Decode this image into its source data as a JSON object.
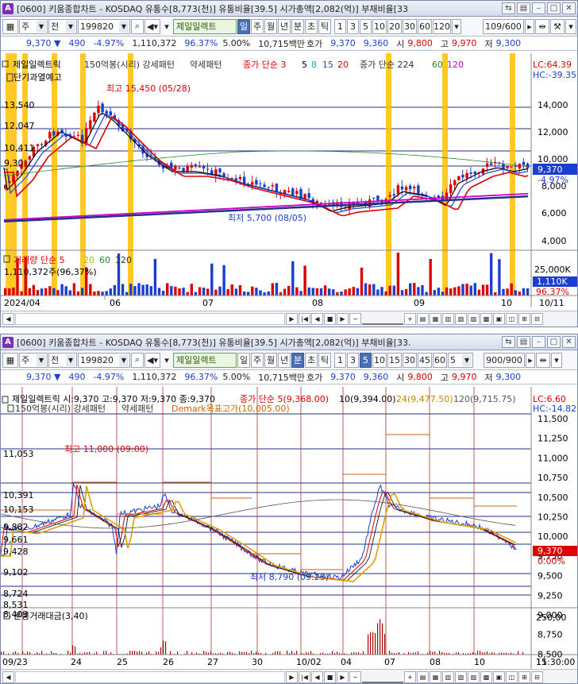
{
  "top": {
    "title": "[0600] 키움종합차트 - KOSDAQ 유통수[8,773(천)] 유통비율[39.5] 시가총액[2,082(억)] 부채비율[33",
    "toolbar": {
      "qty": "주",
      "prev": "전",
      "code": "199820",
      "stock": "제일일렉트",
      "periods": [
        "일",
        "주",
        "월",
        "년",
        "분",
        "초",
        "틱"
      ],
      "active_period": "일",
      "nums": [
        "1",
        "3",
        "5",
        "10",
        "20",
        "30",
        "60",
        "120"
      ],
      "count": "109/600"
    },
    "quote": {
      "price": "9,370 ▼",
      "change": "490",
      "rate": "-4.97%",
      "volume": "1,110,372",
      "vol_rate": "96.37%",
      "pct": "5.00%",
      "amount": "10,715백만",
      "hoga_label": "호가",
      "hoga1": "9,370",
      "hoga2": "9,360",
      "si_label": "시",
      "si": "9,800",
      "go_label": "고",
      "go": "9,970",
      "jeo_label": "저",
      "jeo": "9,300"
    },
    "legend1": "제일일렉트릭",
    "legend2": "150억봉(시리) 강세패턴",
    "legend3": "약세패턴",
    "legend4": "종가 단순 3",
    "l5": "5",
    "l8": "8",
    "l15": "15",
    "l20": "20",
    "legend5": "종가 단순 224",
    "l60": "60",
    "l120": "120",
    "warn": "단기과열예고",
    "high_label": "최고 15,450 (05/28)",
    "low_label": "최저 5,700 (08/05)",
    "lc": "LC:64.39",
    "hc": "HC:-39.35",
    "left_ticks": [
      "13,540",
      "12,047",
      "10,411",
      "9,30"
    ],
    "right_ticks": [
      "14,000",
      "12,000",
      "10,000",
      "8,000",
      "6,000",
      "4,000"
    ],
    "price_tag": "9,370",
    "pct_tag": "-4.97%",
    "vol_legend": "거래량 단순 5",
    "v20": "20",
    "v60": "60",
    "v120": "120",
    "vol_value": "1,110,372주(96,37%)",
    "vol_ticks": [
      "25,000K",
      "10,000K"
    ],
    "vol_tag": "1,110K",
    "vol_pct": "96.37%",
    "dates": [
      "2024/04",
      "06",
      "07",
      "08",
      "09",
      "10",
      "10/11"
    ]
  },
  "bottom": {
    "title": "[0600] 키움종합차트 - KOSDAQ 유통수[8,773(천)] 유통비율[39.5] 시가총액[2,082(억)] 부채비율[33.",
    "toolbar": {
      "qty": "주",
      "prev": "전",
      "code": "199820",
      "stock": "제일일렉트",
      "periods": [
        "일",
        "주",
        "월",
        "년",
        "분",
        "초",
        "틱"
      ],
      "active_period": "분",
      "nums": [
        "1",
        "3",
        "5",
        "10",
        "15",
        "30",
        "45",
        "60"
      ],
      "active_num": "5",
      "count": "900/900"
    },
    "quote": {
      "price": "9,370 ▼",
      "change": "490",
      "rate": "-4.97%",
      "volume": "1,110,372",
      "vol_rate": "96.37%",
      "pct": "5.00%",
      "amount": "10,715백만",
      "hoga_label": "호가",
      "hoga1": "9,370",
      "hoga2": "9,360",
      "si_label": "시",
      "si": "9,800",
      "go_label": "고",
      "go": "9,970",
      "jeo_label": "저",
      "jeo": "9,300"
    },
    "legend1": "제일일렉트릭 시:9,370 고:9,370 저:9,370 종:9,370",
    "legend2": "종가 단순 5(9,368.00)",
    "legend3": "10(9,394.00)",
    "legend4": "24(9,477.50)",
    "legend5": "120(9,715.75)",
    "legend6": "150억봉(시리) 강세패턴",
    "legend7": "약세패턴",
    "legend8": "Demark목표고가(10,005.00)",
    "high_label": "최고 11,000 (09:00)",
    "low_label": "최저 8,790 (09:25)",
    "lc": "LC:6.60",
    "hc": "HC:-14.82",
    "left_ticks": [
      "11,053",
      "10,391",
      "10,153",
      "9,882",
      "9,661",
      "9,428",
      "9,102",
      "8,724",
      "8,531",
      "8,403"
    ],
    "right_ticks": [
      "11,500",
      "11,250",
      "11,000",
      "10,750",
      "10,500",
      "10,250",
      "10,000",
      "9,750",
      "9,500",
      "9,250",
      "9,000",
      "8,750",
      "8,500"
    ],
    "price_tag": "9,370",
    "pct_tag": "0.00%",
    "vol_legend": "분봉거래대금(3,40)",
    "vol_tick": "250,00",
    "dates": [
      "09/23",
      "24",
      "25",
      "26",
      "27",
      "30",
      "10/02",
      "04",
      "07",
      "08",
      "10",
      "11",
      "15:30:00"
    ]
  }
}
